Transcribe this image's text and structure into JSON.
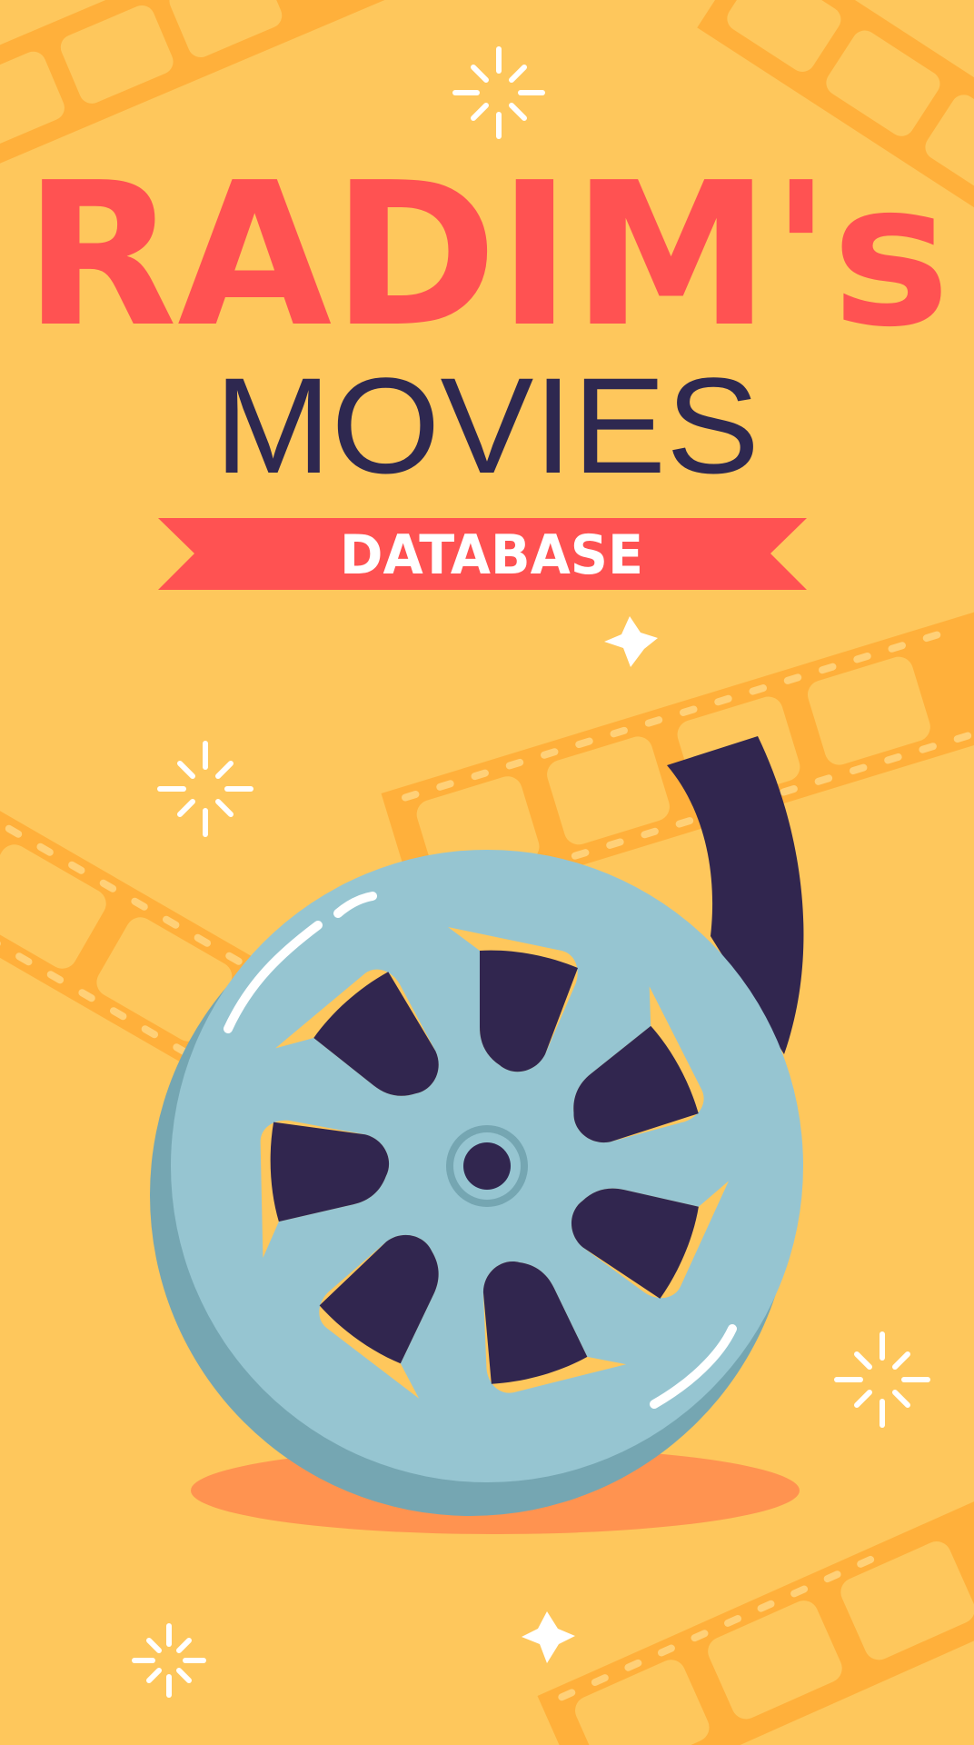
{
  "poster": {
    "title": "RADIM's",
    "subtitle": "MOVIES",
    "ribbon_label": "DATABASE"
  },
  "colors": {
    "background": "#FEC75C",
    "title": "#FF5252",
    "subtitle": "#2E2850",
    "ribbon": "#FF5252",
    "ribbon_text": "#FFFFFF",
    "film_strip": "#FFB03B",
    "film_hole": "#FFC763",
    "reel_face": "#96C5D1",
    "reel_shadow": "#75A6B2",
    "reel_film": "#31264F",
    "floor_shadow": "#FF9350",
    "sparkle": "#FFFFFF"
  },
  "icons": [
    "film-strip-icon",
    "film-reel-icon",
    "sparkle-icon",
    "star-icon"
  ]
}
